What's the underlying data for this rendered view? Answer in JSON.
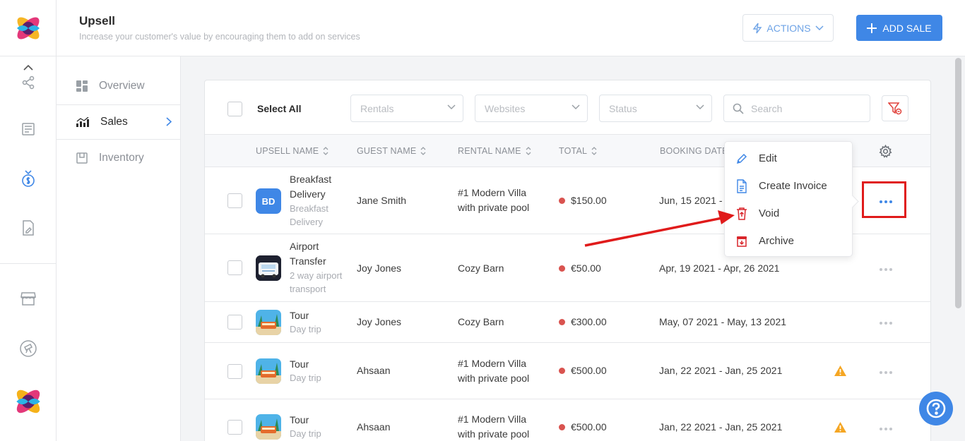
{
  "header": {
    "title": "Upsell",
    "subtitle": "Increase your customer's value by encouraging them to add on services",
    "actions_label": "ACTIONS",
    "add_sale_label": "ADD SALE"
  },
  "rail": {
    "icons": [
      "share-icon",
      "ledger-icon",
      "moneybag-icon",
      "document-edit-icon",
      "store-icon",
      "telescope-icon"
    ]
  },
  "subnav": {
    "items": [
      {
        "label": "Overview",
        "icon": "overview-icon"
      },
      {
        "label": "Sales",
        "icon": "sales-chart-icon"
      },
      {
        "label": "Inventory",
        "icon": "inventory-icon"
      }
    ]
  },
  "filters": {
    "select_all_label": "Select All",
    "rentals_placeholder": "Rentals",
    "websites_placeholder": "Websites",
    "status_placeholder": "Status",
    "search_placeholder": "Search"
  },
  "table": {
    "columns": [
      "UPSELL NAME",
      "GUEST NAME",
      "RENTAL NAME",
      "TOTAL",
      "BOOKING DATES"
    ],
    "rows": [
      {
        "initials": "BD",
        "name_line1": "Breakfast",
        "name_line2": "Delivery",
        "desc_line1": "Breakfast",
        "desc_line2": "Delivery",
        "guest": "Jane Smith",
        "rental_line1": "#1 Modern Villa",
        "rental_line2": "with private pool",
        "total": "$150.00",
        "dates": "Jun, 15 2021 -",
        "warning": false
      },
      {
        "initials": "",
        "name_line1": "Airport",
        "name_line2": "Transfer",
        "desc_line1": "2 way airport",
        "desc_line2": "transport",
        "guest": "Joy Jones",
        "rental_line1": "Cozy Barn",
        "rental_line2": "",
        "total": "€50.00",
        "dates": "Apr, 19 2021 - Apr, 26 2021",
        "warning": false
      },
      {
        "initials": "",
        "name_line1": "Tour",
        "name_line2": "",
        "desc_line1": "Day trip",
        "desc_line2": "",
        "guest": "Joy Jones",
        "rental_line1": "Cozy Barn",
        "rental_line2": "",
        "total": "€300.00",
        "dates": "May, 07 2021 - May, 13 2021",
        "warning": false
      },
      {
        "initials": "",
        "name_line1": "Tour",
        "name_line2": "",
        "desc_line1": "Day trip",
        "desc_line2": "",
        "guest": "Ahsaan",
        "rental_line1": "#1 Modern Villa",
        "rental_line2": "with private pool",
        "total": "€500.00",
        "dates": "Jan, 22 2021 - Jan, 25 2021",
        "warning": true
      },
      {
        "initials": "",
        "name_line1": "Tour",
        "name_line2": "",
        "desc_line1": "Day trip",
        "desc_line2": "",
        "guest": "Ahsaan",
        "rental_line1": "#1 Modern Villa",
        "rental_line2": "with private pool",
        "total": "€500.00",
        "dates": "Jan, 22 2021 - Jan, 25 2021",
        "warning": true
      }
    ]
  },
  "row_menu": {
    "items": [
      {
        "label": "Edit",
        "icon": "pencil-icon"
      },
      {
        "label": "Create Invoice",
        "icon": "invoice-icon"
      },
      {
        "label": "Void",
        "icon": "trash-icon"
      },
      {
        "label": "Archive",
        "icon": "archive-icon"
      }
    ]
  },
  "colors": {
    "primary": "#3f87e6",
    "status_dot": "#d9534f",
    "warning": "#f5a623",
    "annotation": "#e01b1b"
  }
}
